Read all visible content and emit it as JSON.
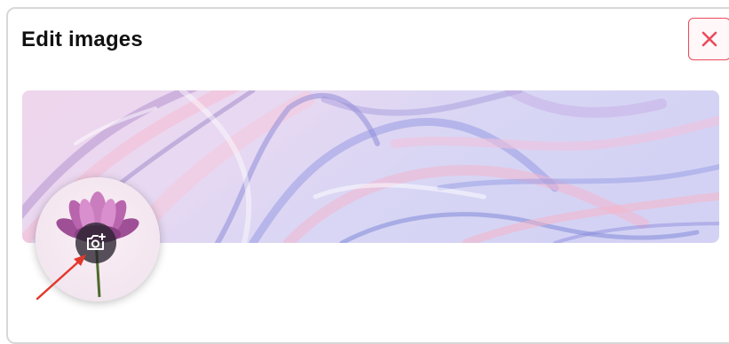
{
  "dialog": {
    "title": "Edit images",
    "close_icon": "close-icon",
    "accent_color": "#e94a5a"
  },
  "banner": {
    "description_icon": "marble-banner-image"
  },
  "avatar": {
    "image_icon": "lotus-flower-image",
    "camera_icon": "camera-plus-icon"
  },
  "annotation": {
    "arrow_color": "#e2372b"
  }
}
